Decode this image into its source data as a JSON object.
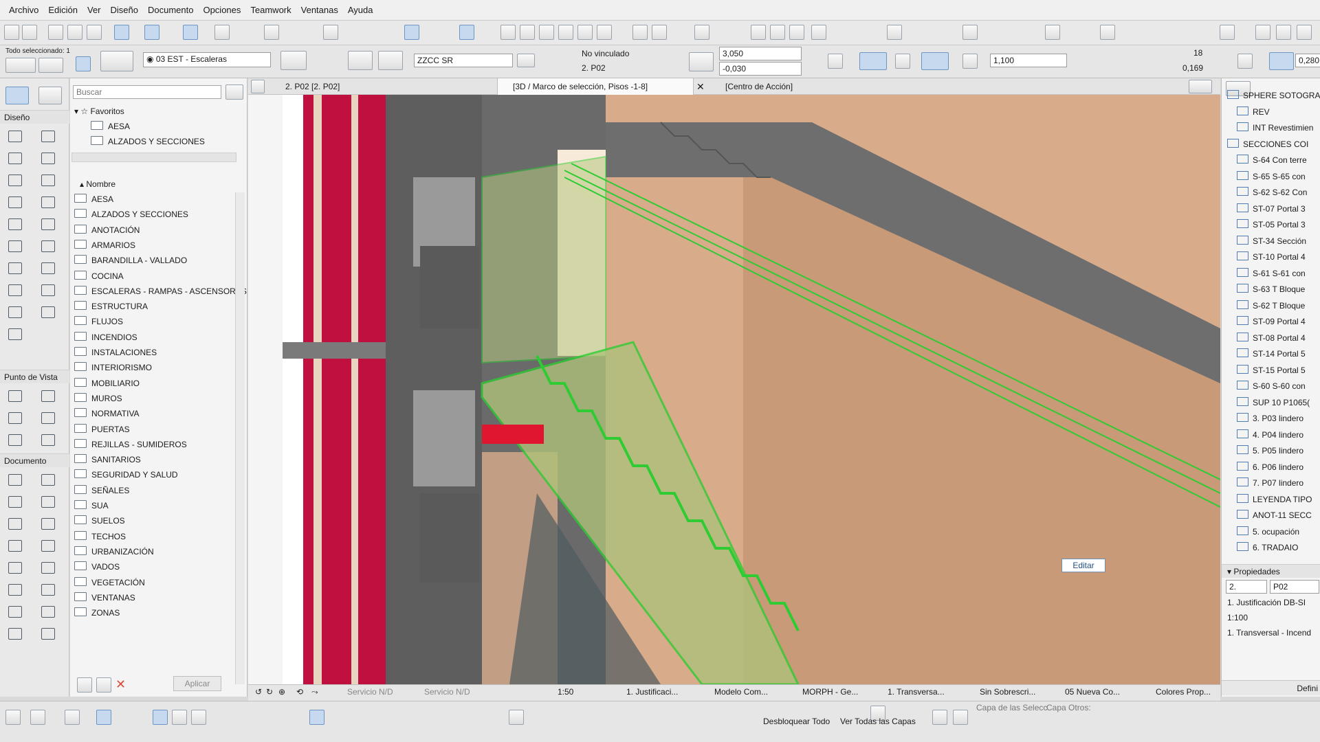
{
  "menu": [
    "Archivo",
    "Edición",
    "Ver",
    "Diseño",
    "Documento",
    "Opciones",
    "Teamwork",
    "Ventanas",
    "Ayuda"
  ],
  "info_box": {
    "selected": "Todo seleccionado: 1",
    "layer": "03 EST - Escaleras",
    "profile": "ZZCC SR",
    "link_status": "No vinculado",
    "story": "2. P02",
    "top_offset": "3,050",
    "bottom_offset": "-0,030",
    "width": "1,100",
    "risers": "18",
    "riser_height": "0,169",
    "tread": "0,280"
  },
  "toolbox": {
    "sections": [
      "Diseño",
      "Punto de Vista",
      "Documento"
    ]
  },
  "navigator": {
    "search_placeholder": "Buscar",
    "favorites_label": "Favoritos",
    "favorites": [
      "AESA",
      "ALZADOS Y SECCIONES"
    ],
    "column_header": "Nombre",
    "folders": [
      "AESA",
      "ALZADOS Y SECCIONES",
      "ANOTACIÓN",
      "ARMARIOS",
      "BARANDILLA - VALLADO",
      "COCINA",
      "ESCALERAS - RAMPAS - ASCENSORES",
      "ESTRUCTURA",
      "FLUJOS",
      "INCENDIOS",
      "INSTALACIONES",
      "INTERIORISMO",
      "MOBILIARIO",
      "MUROS",
      "NORMATIVA",
      "PUERTAS",
      "REJILLAS - SUMIDEROS",
      "SANITARIOS",
      "SEGURIDAD Y SALUD",
      "SEÑALES",
      "SUA",
      "SUELOS",
      "TECHOS",
      "URBANIZACIÓN",
      "VADOS",
      "VEGETACIÓN",
      "VENTANAS",
      "ZONAS"
    ],
    "apply_label": "Aplicar"
  },
  "tabs": [
    {
      "label": "2. P02 [2. P02]"
    },
    {
      "label": "[3D / Marco de selección, Pisos -1-8]"
    },
    {
      "label": "[Centro de Acción]"
    }
  ],
  "viewport": {
    "edit_label": "Editar"
  },
  "right_panel": {
    "items": [
      "SPHERE SOTOGRA",
      "REV",
      "INT Revestimien",
      "SECCIONES COI",
      "S-64 Con terre",
      "S-65 S-65 con",
      "S-62 S-62 Con",
      "ST-07 Portal 3",
      "ST-05 Portal 3",
      "ST-34 Sección",
      "ST-10 Portal 4",
      "S-61 S-61 con",
      "S-63 T Bloque",
      "S-62 T Bloque",
      "ST-09 Portal 4",
      "ST-08 Portal 4",
      "ST-14 Portal 5",
      "ST-15 Portal 5",
      "S-60 S-60 con",
      "SUP 10 P1065(",
      "3. P03 lindero",
      "4. P04 lindero",
      "5. P05 lindero",
      "6. P06 lindero",
      "7. P07 lindero",
      "LEYENDA TIPO",
      "ANOT-11 SECC",
      "5. ocupación",
      "6. TRADAIO"
    ],
    "properties_label": "Propiedades",
    "prop_id": "2.",
    "prop_name": "P02",
    "prop_rows": [
      "1. Justificación DB-SI",
      "1:100",
      "1. Transversal - Incend"
    ],
    "define_label": "Defini"
  },
  "status_bar": {
    "undo_service": "Servicio N/D",
    "redo_service": "Servicio N/D",
    "scale": "1:50",
    "layer_combo": "1. Justificaci...",
    "model_view": "Modelo Com...",
    "morph": "MORPH - Ge...",
    "pen_set": "1. Transversa...",
    "overrides": "Sin Sobrescri...",
    "renovation": "05 Nueva Co...",
    "colors": "Colores Prop..."
  },
  "bottom_bar": {
    "unlock_all": "Desbloquear Todo",
    "show_all_layers": "Ver Todas las Capas",
    "selection_layer": "Capa de las Selecc",
    "other_layer": "Capa Otros:"
  },
  "colors": {
    "accent_red": "#c0103f",
    "selection_green": "#2ecc32",
    "wall_tan": "#d9ab88"
  }
}
